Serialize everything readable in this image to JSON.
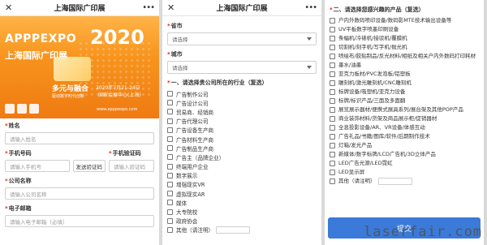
{
  "app": {
    "title": "上海国际广印展",
    "close_glyph": "✕",
    "more_glyph": "•••"
  },
  "banner": {
    "brand": "APPPEXPO",
    "year": "2020",
    "zh_name": "上海国际广印展",
    "slogan": "多元与融合",
    "slogan_sub": "驱动数字时代创新",
    "date": "2020年7月21-24日",
    "venue": "国家会展中心(上海)",
    "url": "www.apppexpo.com"
  },
  "form": {
    "name": {
      "label": "姓名",
      "placeholder": "请输入姓名"
    },
    "phone": {
      "label": "手机号码",
      "placeholder": "请输入手机号"
    },
    "send_code": "发送验证码",
    "code": {
      "label": "手机验证码",
      "placeholder": "请输入验证码"
    },
    "company": {
      "label": "公司名称",
      "placeholder": "请输入公司名称"
    },
    "email": {
      "label": "电子邮箱",
      "placeholder": "请输入电子邮箱（必填）"
    }
  },
  "location": {
    "province_label": "省市",
    "province_value": "请选择",
    "city_label": "城市",
    "city_value": "请选择"
  },
  "industry": {
    "title": "一、请选择贵公司所在的行业（复选）",
    "options": [
      "广告制作公司",
      "广告设计公司",
      "贸易商、经销商",
      "广告代理公司",
      "广告设备生产商",
      "广告材料生产商",
      "广告制品生产商",
      "广告主（品牌企业）",
      "终端用户企业",
      "数字展示",
      "增强现实VR",
      "虚拟现实AR",
      "媒体",
      "大专院校",
      "政府协会",
      "其他（请注明）"
    ]
  },
  "products": {
    "title": "二、请选择您感兴趣的产品（复选）",
    "options": [
      "户内外数码喷印设备/数码影MTE技术输出设备等",
      "UV平板数字喷墨印刷设备",
      "条幅机/冷裱机/接驳机/覆膜机",
      "切割机/刻字机/写字机/抛光机",
      "喷绘布/胶贴制品/反光材料/相纸及相关户内外数码打印耗材",
      "墨水/油墨",
      "亚克力板材/PVC发泡板/铝塑板",
      "雕刻机/激光雕刻机/CNC雕刻机",
      "标牌设备/吸塑机/亚克力设备",
      "标牌/标识产品/三面及多面翻",
      "展览展示器材/便携式展具系列/展台架及其他POP产品",
      "商业装饰材料/货架及商品展示柜/促销器材",
      "全息投影设备/AR、VR设备/体感互动",
      "广告礼品/书籍/图库/软件/后期制作技术",
      "灯箱/发光产品",
      "新媒体/数字标牌/LCD广告机/3D立体产品",
      "LED广告光源/LED霓虹",
      "LED显示屏",
      "其他（请注明）"
    ]
  },
  "submit_label": "提交",
  "watermark": "laserfair.com",
  "colors": {
    "banner": "#f7941d",
    "submit": "#3b7ad9",
    "required": "#e02020"
  }
}
